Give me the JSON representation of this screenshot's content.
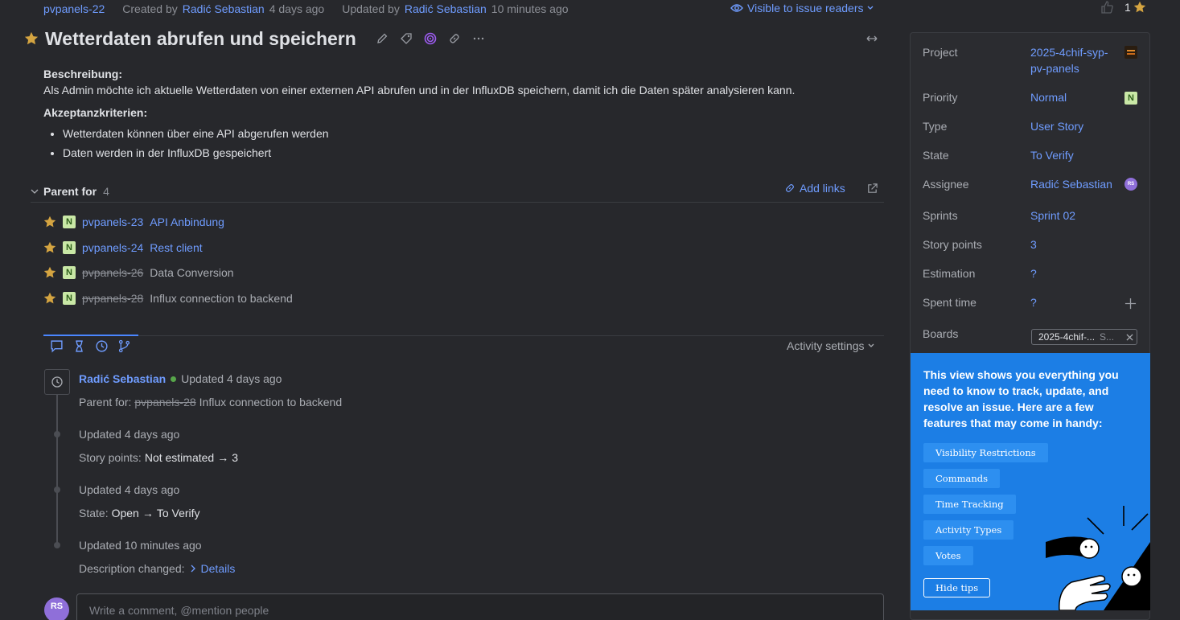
{
  "top": {
    "issue_id": "pvpanels-22",
    "created_label": "Created by",
    "created_by": "Radić Sebastian",
    "created_ago": "4 days ago",
    "updated_label": "Updated by",
    "updated_by": "Radić Sebastian",
    "updated_ago": "10 minutes ago",
    "visibility": "Visible to issue readers",
    "vote_count": "1"
  },
  "issue": {
    "title": "Wetterdaten abrufen und speichern",
    "desc_heading": "Beschreibung:",
    "desc_text": "Als Admin möchte ich aktuelle Wetterdaten von einer externen API abrufen und in der InfluxDB speichern, damit ich die Daten später analysieren kann.",
    "criteria_heading": "Akzeptanzkriterien:",
    "criteria": [
      "Wetterdaten können über eine API abgerufen werden",
      "Daten werden in der InfluxDB gespeichert"
    ]
  },
  "parent": {
    "title": "Parent for",
    "count": "4",
    "add_links": "Add links",
    "items": [
      {
        "id": "pvpanels-23",
        "summary": "API Anbindung",
        "badge": "N"
      },
      {
        "id": "pvpanels-24",
        "summary": "Rest client",
        "badge": "N"
      },
      {
        "id": "pvpanels-26",
        "summary": "Data Conversion",
        "badge": "N"
      },
      {
        "id": "pvpanels-28",
        "summary": "Influx connection to backend",
        "badge": "N"
      }
    ]
  },
  "activity": {
    "settings_label": "Activity settings",
    "author": "Radić Sebastian",
    "entries": [
      {
        "updated": "Updated 4 days ago",
        "field": "Parent for:",
        "from": "pvpanels-28",
        "to": "Influx connection to backend"
      },
      {
        "updated": "Updated 4 days ago",
        "field": "Story points:",
        "from": "Not estimated",
        "arrow": "→",
        "to": "3"
      },
      {
        "updated": "Updated 4 days ago",
        "field": "State:",
        "from": "Open",
        "arrow": "→",
        "to": "To Verify"
      },
      {
        "updated": "Updated 10 minutes ago",
        "field": "Description changed:",
        "to": "Details"
      }
    ],
    "comment_placeholder": "Write a comment, @mention people",
    "avatar_initials": "RS"
  },
  "props": {
    "project_label": "Project",
    "project_value_1": "2025-4chif-syp-",
    "project_value_2": "pv-panels",
    "priority_label": "Priority",
    "priority_value": "Normal",
    "priority_badge": "N",
    "type_label": "Type",
    "type_value": "User Story",
    "state_label": "State",
    "state_value": "To Verify",
    "assignee_label": "Assignee",
    "assignee_value": "Radić Sebastian",
    "assignee_initials": "RS",
    "sprints_label": "Sprints",
    "sprints_value": "Sprint 02",
    "story_points_label": "Story points",
    "story_points_value": "3",
    "estimation_label": "Estimation",
    "estimation_value": "?",
    "spent_time_label": "Spent time",
    "spent_time_value": "?",
    "boards_label": "Boards",
    "boards_chip": "2025-4chif-...",
    "boards_chip_suffix": "S..."
  },
  "tips": {
    "text": "This view shows you everything you need to know to track, update, and resolve an issue. Here are a few features that may come in handy:",
    "buttons": [
      "Visibility Restrictions",
      "Commands",
      "Time Tracking",
      "Activity Types",
      "Votes"
    ],
    "hide": "Hide tips"
  },
  "colors": {
    "accent": "#6f9cff",
    "background": "#27282c",
    "tips_bg": "#1c7ee5",
    "star": "#d4a441"
  }
}
